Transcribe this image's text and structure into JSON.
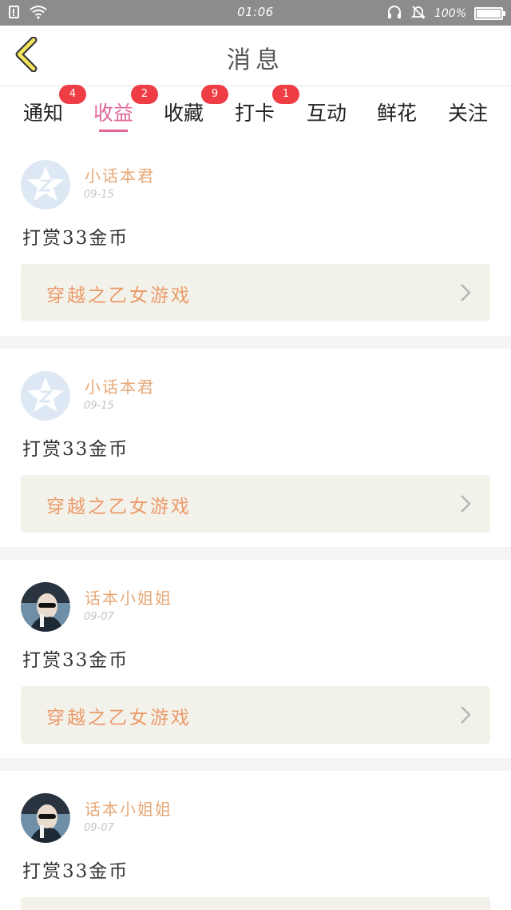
{
  "status_bar": {
    "time": "01:06",
    "battery_percent": "100%",
    "icons": [
      "notification-icon",
      "wifi-icon",
      "headset-icon",
      "mute-icon",
      "battery-icon"
    ]
  },
  "header": {
    "title": "消息",
    "back_icon": "chevron-left-icon"
  },
  "tabs": [
    {
      "label": "通知",
      "badge": "4",
      "active": false
    },
    {
      "label": "收益",
      "badge": "2",
      "active": true
    },
    {
      "label": "收藏",
      "badge": "9",
      "active": false
    },
    {
      "label": "打卡",
      "badge": "1",
      "active": false
    },
    {
      "label": "互动",
      "badge": "",
      "active": false
    },
    {
      "label": "鲜花",
      "badge": "",
      "active": false
    },
    {
      "label": "关注",
      "badge": "",
      "active": false
    }
  ],
  "colors": {
    "accent": "#e0679b",
    "badge": "#ef3d45",
    "username": "#e8a877",
    "book_title": "#eb9a69",
    "status_bar": "#8c8c8c"
  },
  "feed": [
    {
      "user": "小话本君",
      "date": "09-15",
      "message": "打赏33金币",
      "book": "穿越之乙女游戏",
      "avatar": "qzone-avatar"
    },
    {
      "user": "小话本君",
      "date": "09-15",
      "message": "打赏33金币",
      "book": "穿越之乙女游戏",
      "avatar": "qzone-avatar"
    },
    {
      "user": "话本小姐姐",
      "date": "09-07",
      "message": "打赏33金币",
      "book": "穿越之乙女游戏",
      "avatar": "photo-avatar"
    },
    {
      "user": "话本小姐姐",
      "date": "09-07",
      "message": "打赏33金币",
      "book": "",
      "avatar": "photo-avatar"
    }
  ]
}
